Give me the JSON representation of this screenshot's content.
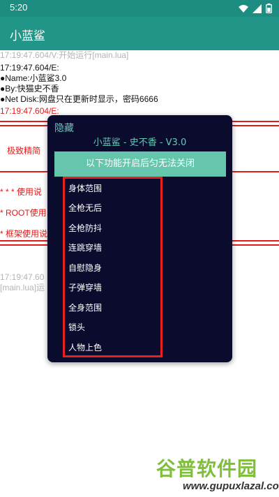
{
  "status_bar": {
    "time": "5:20"
  },
  "app_bar": {
    "title": "小蓝鲨"
  },
  "log": {
    "line1": "17:19:47.604/V:开始运行[main.lua]",
    "line2": "17:19:47.604/E:",
    "line3": "●Name:小蓝鲨3.0",
    "line4": "●By:快猫史不香",
    "line5": "●Net Disk:网盘只在更新时显示，密码6666",
    "line6": "17:19:47.604/E:",
    "partial1": "极致精简",
    "partial2": "* * * 使用说",
    "partial3": "* ROOT使用",
    "partial4": "* 框架使用说",
    "partial5": "17:19:47.60",
    "partial6": "[main.lua]运"
  },
  "overlay": {
    "hide_label": "隐藏",
    "title": "小蓝鲨 - 史不香 - V3.0",
    "banner": "以下功能开启后匀无法关闭",
    "items": [
      "身体范围",
      "全枪无后",
      "全枪防抖",
      "连跳穿墙",
      "自慰隐身",
      "子弹穿墙",
      "全身范围",
      "锁头",
      "人物上色"
    ]
  },
  "watermark": {
    "main": "谷普软件园",
    "url": "www.gupuxlazal.com"
  },
  "colors": {
    "teal": "#219688",
    "red": "#e11a1a",
    "overlay_bg": "#0b0b2e",
    "accent": "#63c9b5"
  }
}
